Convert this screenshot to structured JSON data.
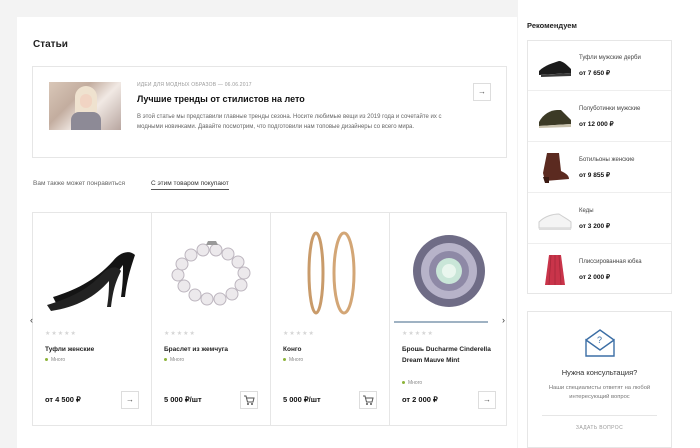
{
  "articles": {
    "section_title": "Статьи",
    "item": {
      "category": "Идеи для модных образов",
      "separator": "—",
      "date": "06.06.2017",
      "title": "Лучшие тренды от стилистов на лето",
      "text": "В этой статье мы представили главные тренды сезона. Носите любимые вещи из 2019 года и сочетайте их с модными новинками. Давайте посмотрим, что подготовили нам топовые дизайнеры со всего мира.",
      "arrow": "→"
    }
  },
  "tabs": {
    "items": [
      {
        "label": "Вам также может понравиться",
        "active": false
      },
      {
        "label": "С этим товаром покупают",
        "active": true
      }
    ]
  },
  "products": {
    "prev_arrow": "‹",
    "next_arrow": "›",
    "items": [
      {
        "name": "Туфли женские",
        "stock": "Много",
        "price": "от 4 500 ₽",
        "rating_stars": "★★★★★",
        "rating": 0,
        "action": "arrow",
        "action_glyph": "→",
        "image": "heels-icon"
      },
      {
        "name": "Браслет из жемчуга",
        "stock": "Много",
        "price": "5 000 ₽/шт",
        "rating_stars": "★★★★★",
        "rating": 0,
        "action": "cart",
        "image": "pearl-bracelet-icon"
      },
      {
        "name": "Конго",
        "stock": "Много",
        "price": "5 000 ₽/шт",
        "rating_stars": "★★★★★",
        "rating": 0,
        "action": "cart",
        "image": "hoop-earrings-icon"
      },
      {
        "name": "Брошь Ducharme Cinderella Dream Mauve Mint",
        "stock": "Много",
        "price": "от 2 000 ₽",
        "rating_stars": "★★★★★",
        "rating": 0,
        "action": "arrow",
        "action_glyph": "→",
        "image": "brooch-icon"
      }
    ]
  },
  "sidebar": {
    "title": "Рекомендуем",
    "items": [
      {
        "name": "Туфли мужские дерби",
        "price": "от 7 650 ₽",
        "image": "derby-shoes-icon"
      },
      {
        "name": "Полуботинки мужские",
        "price": "от 12 000 ₽",
        "image": "low-boots-icon"
      },
      {
        "name": "Ботильоны женские",
        "price": "от 9 855 ₽",
        "image": "ankle-boots-icon"
      },
      {
        "name": "Кеды",
        "price": "от 3 200 ₽",
        "image": "sneakers-icon"
      },
      {
        "name": "Плиссированная юбка",
        "price": "от 2 000 ₽",
        "image": "pleated-skirt-icon"
      }
    ],
    "consult": {
      "title": "Нужна консультация?",
      "text": "Наши специалисты ответят на любой интересующий вопрос",
      "link": "ЗАДАТЬ ВОПРОС",
      "icon": "mail-question-icon"
    }
  },
  "colors": {
    "in_stock_dot": "#8cb339",
    "price_text": "#111111",
    "star_inactive": "#d5d5d5"
  }
}
